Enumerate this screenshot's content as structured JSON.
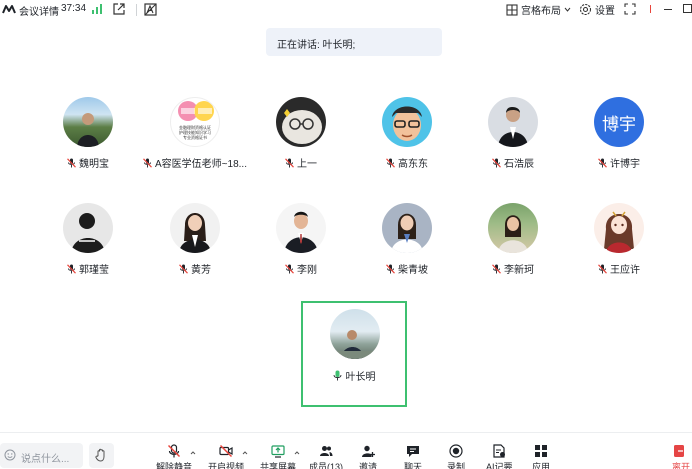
{
  "header": {
    "meeting_title": "会议详情",
    "timer": "37:34",
    "layout_label": "宫格布局",
    "settings_label": "设置"
  },
  "speaking": {
    "text": "正在讲话: 叶长明;"
  },
  "participants": [
    {
      "name": "魏明宝",
      "avatar": "photo"
    },
    {
      "name": "A容医学伍老师~18...",
      "avatar": "poster"
    },
    {
      "name": "上一",
      "avatar": "cat"
    },
    {
      "name": "高东东",
      "avatar": "cartoon"
    },
    {
      "name": "石浩辰",
      "avatar": "photo"
    },
    {
      "name": "许博宇",
      "avatar": "text",
      "avatar_text": "博宇",
      "avatar_color": "#2f6fe0"
    },
    {
      "name": "郭瑾莹",
      "avatar": "photo"
    },
    {
      "name": "黄芳",
      "avatar": "photo"
    },
    {
      "name": "李刚",
      "avatar": "photo"
    },
    {
      "name": "柴青坡",
      "avatar": "photo"
    },
    {
      "name": "李新珂",
      "avatar": "photo"
    },
    {
      "name": "王应许",
      "avatar": "anime"
    }
  ],
  "speaker": {
    "name": "叶长明",
    "border_color": "#3ec070"
  },
  "poster_lines": [
    "金融理财资格认证",
    "护理技能知识学习",
    "专业资格证书"
  ],
  "toolbar": {
    "chat_placeholder": "说点什么...",
    "unmute": "解除静音",
    "video": "开启视频",
    "share": "共享屏幕",
    "members": "成员(13)",
    "invite": "邀请",
    "chat": "聊天",
    "record": "录制",
    "ai_notes": "AI记要",
    "apps": "应用",
    "leave": "离开"
  },
  "colors": {
    "accent_green": "#3ec070",
    "leave_red": "#e54545",
    "mic_off_red": "#e8453c"
  }
}
